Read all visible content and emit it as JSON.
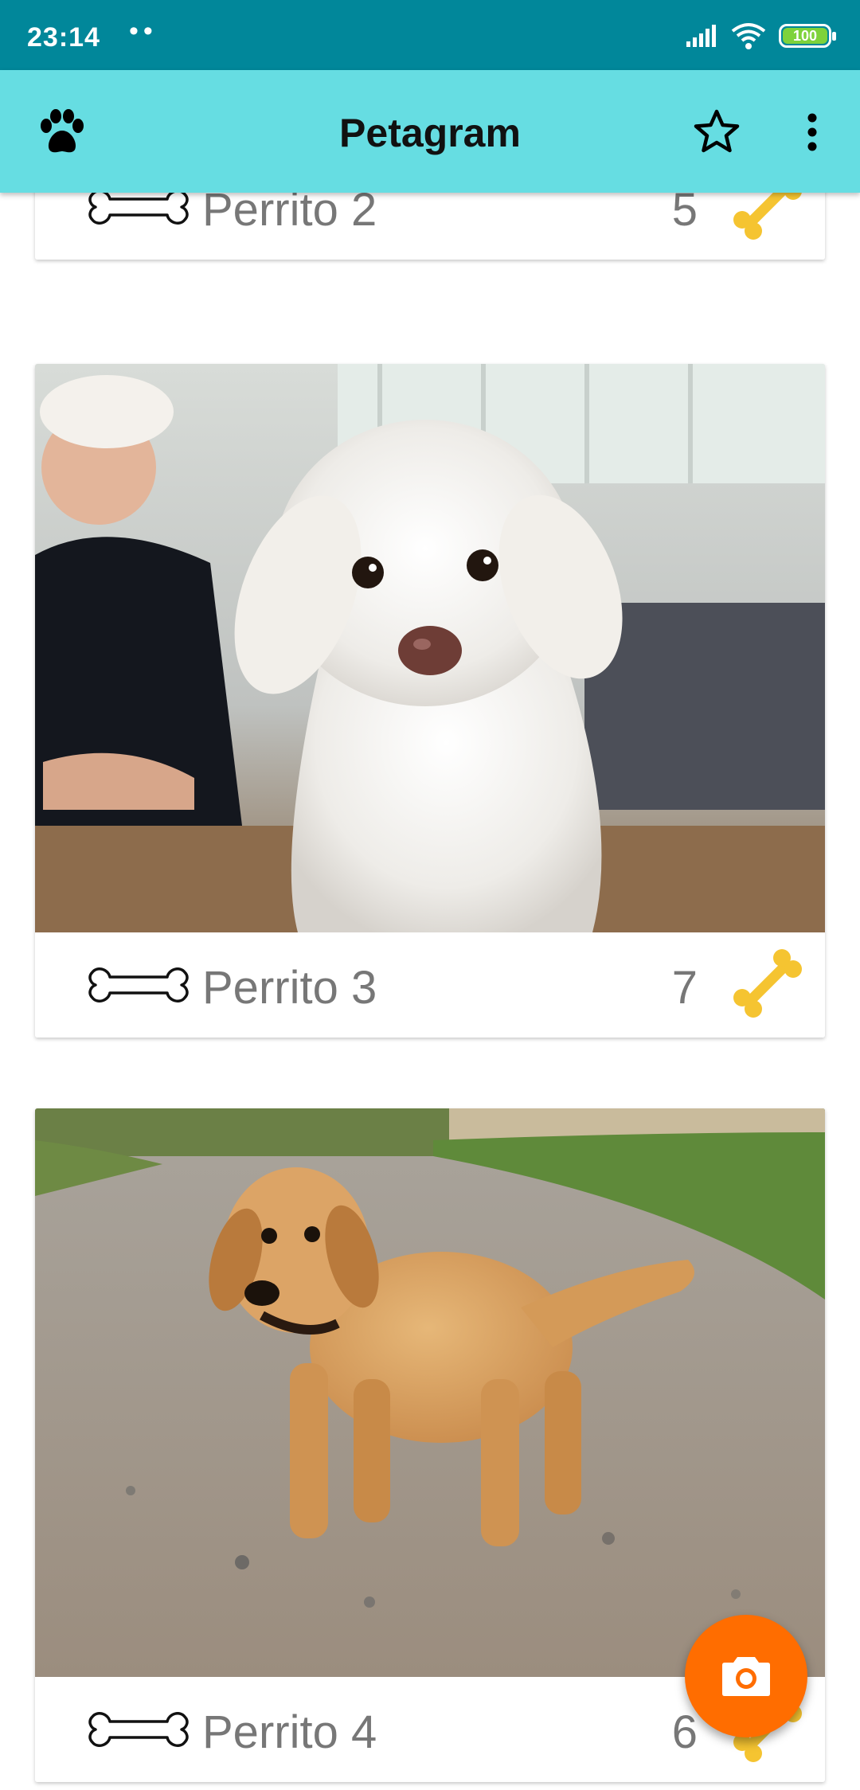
{
  "status_bar": {
    "time": "23:14",
    "notification_dots": "••",
    "battery": "100",
    "icons": [
      "signal-icon",
      "wifi-icon",
      "battery-icon"
    ]
  },
  "app_bar": {
    "title": "Petagram",
    "logo_icon": "paw-icon",
    "actions": [
      "star-icon",
      "more-vert-icon"
    ]
  },
  "pets": [
    {
      "name": "Perrito 2",
      "likes": "5"
    },
    {
      "name": "Perrito 3",
      "likes": "7"
    },
    {
      "name": "Perrito 4",
      "likes": "6"
    }
  ],
  "fab": {
    "icon": "camera-icon"
  },
  "colors": {
    "status_bar": "#01879a",
    "app_bar": "#66dde2",
    "fab": "#ff6d00",
    "bone_gold": "#f5c431"
  }
}
